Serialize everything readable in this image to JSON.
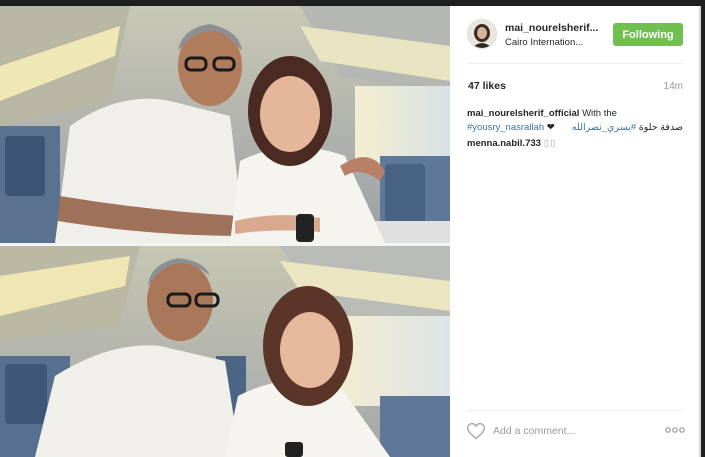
{
  "post": {
    "username": "mai_nourelsherif...",
    "location": "Cairo Internation...",
    "follow_label": "Following",
    "likes": "47 likes",
    "time": "14m",
    "caption": {
      "user": "mai_nourelsherif_official",
      "text": " With the",
      "hashtag": "#yousry_nasrallah",
      "heart": "❤",
      "arabic_tag": "#يسري_نصرالله",
      "arabic_text": "صدفة حلوة"
    },
    "comments": [
      {
        "user": "menna.nabil.733",
        "text": ""
      }
    ],
    "add_comment_placeholder": "Add a comment...",
    "more_label": "ooo"
  },
  "icons": {
    "heart": "heart-outline-icon",
    "more": "more-options-icon",
    "avatar": "profile-avatar"
  },
  "colors": {
    "follow_button": "#70c050",
    "hashtag": "#3f729b",
    "background": "#1f1f1f"
  }
}
